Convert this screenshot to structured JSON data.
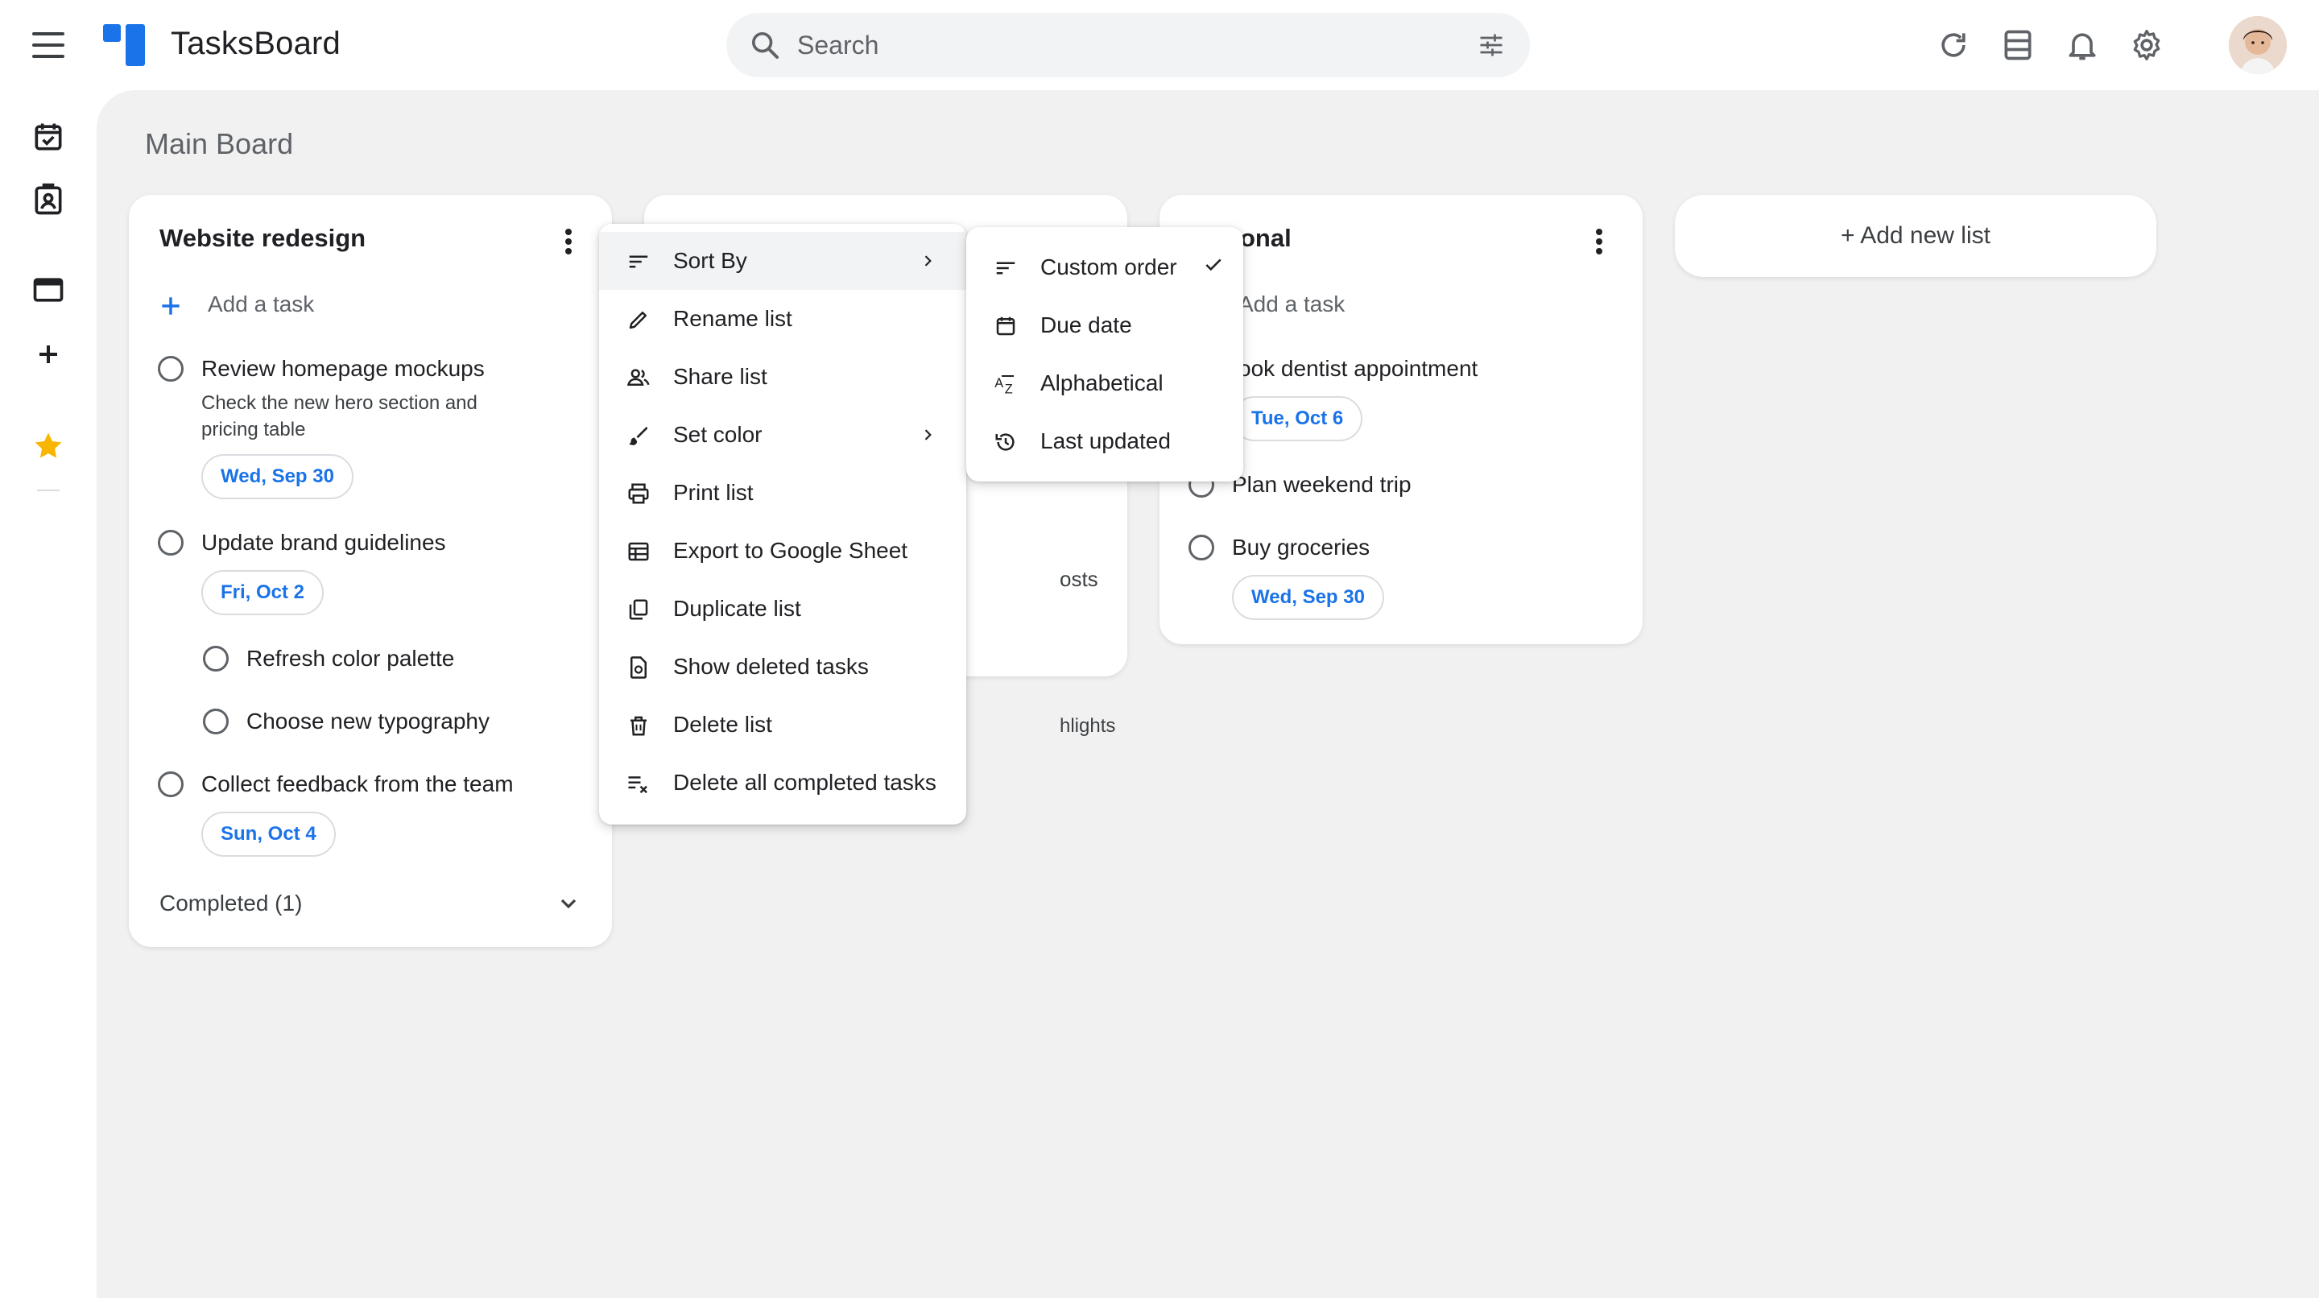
{
  "app": {
    "title": "TasksBoard"
  },
  "search": {
    "placeholder": "Search"
  },
  "board": {
    "title": "Main Board"
  },
  "lists": [
    {
      "title": "Website redesign",
      "add_task_label": "Add a task",
      "tasks": [
        {
          "title": "Review homepage mockups",
          "note": "Check the new hero section and pricing table",
          "date": "Wed, Sep 30"
        },
        {
          "title": "Update brand guidelines",
          "date": "Fri, Oct 2"
        },
        {
          "title": "Refresh color palette"
        },
        {
          "title": "Choose new typography"
        },
        {
          "title": "Collect feedback from the team",
          "date": "Sun, Oct 4"
        }
      ],
      "completed_label": "Completed (1)"
    },
    {
      "partial_texts": [
        "osts",
        "hlights"
      ]
    },
    {
      "title": "onal",
      "add_task_label": "Add a task",
      "tasks": [
        {
          "title": "ook dentist appointment",
          "date": "Tue, Oct 6"
        },
        {
          "title": "Plan weekend trip"
        },
        {
          "title": "Buy groceries",
          "date": "Wed, Sep 30"
        }
      ]
    }
  ],
  "add_list_label": "+ Add new list",
  "menu": {
    "items": [
      {
        "label": "Sort By",
        "icon": "sort-icon"
      },
      {
        "label": "Rename list",
        "icon": "pencil-icon"
      },
      {
        "label": "Share list",
        "icon": "people-icon"
      },
      {
        "label": "Set color",
        "icon": "brush-icon"
      },
      {
        "label": "Print list",
        "icon": "printer-icon"
      },
      {
        "label": "Export to Google Sheet",
        "icon": "table-icon"
      },
      {
        "label": "Duplicate list",
        "icon": "copy-icon"
      },
      {
        "label": "Show deleted tasks",
        "icon": "restore-page-icon"
      },
      {
        "label": "Delete list",
        "icon": "trash-icon"
      },
      {
        "label": "Delete all completed tasks",
        "icon": "clear-all-icon"
      }
    ]
  },
  "submenu": {
    "items": [
      {
        "label": "Custom order",
        "icon": "sort-icon",
        "checked": true
      },
      {
        "label": "Due date",
        "icon": "calendar-icon"
      },
      {
        "label": "Alphabetical",
        "icon": "az-icon"
      },
      {
        "label": "Last updated",
        "icon": "history-icon"
      }
    ]
  },
  "colors": {
    "accent": "#1a73e8",
    "star": "#f9b600",
    "canvas": "#f1f1f1"
  }
}
